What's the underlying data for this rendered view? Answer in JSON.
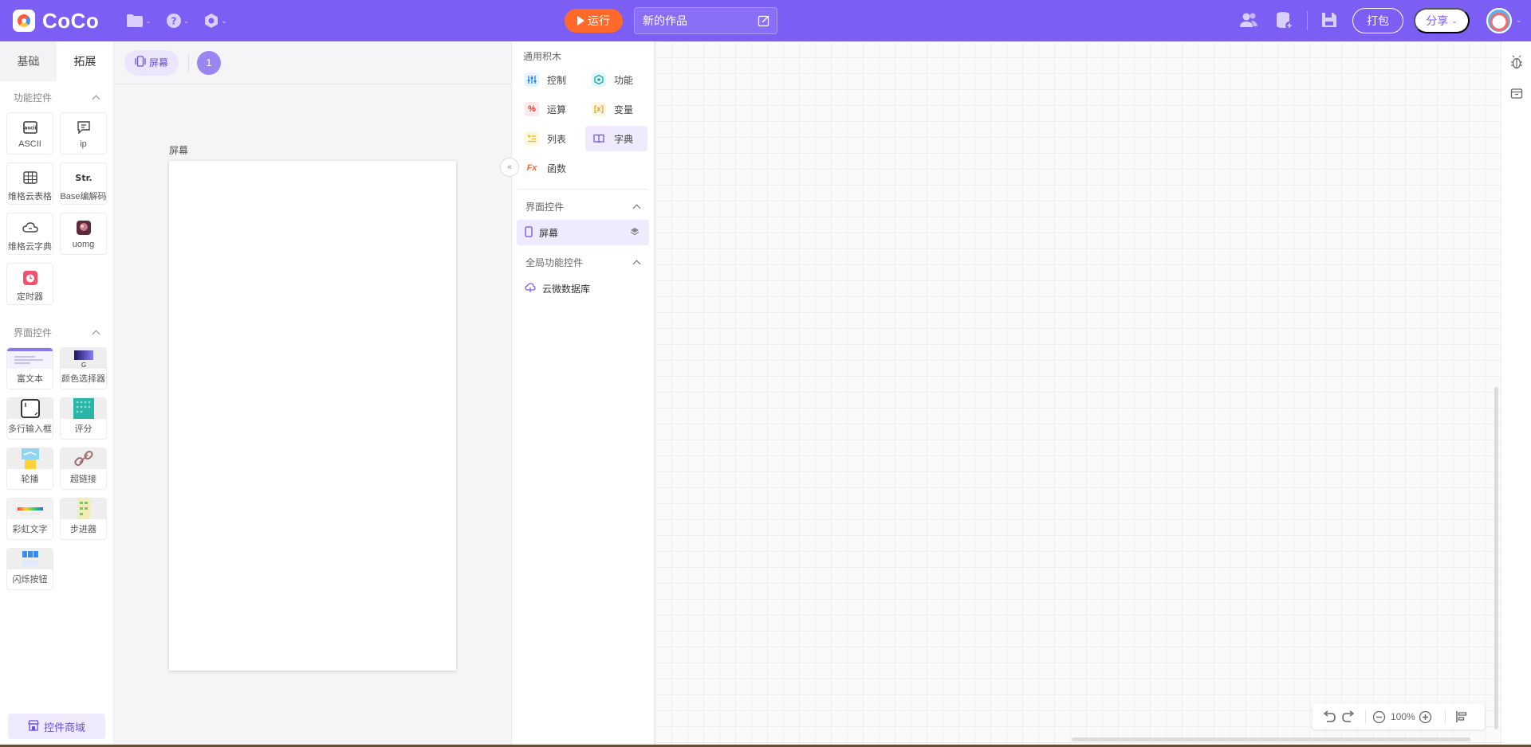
{
  "app": {
    "name": "CoCo"
  },
  "toolbar": {
    "file_icon": "folder-icon",
    "help_icon": "help-icon",
    "settings_icon": "settings-icon",
    "run_label": "运行",
    "project_title": "新的作品",
    "pack_label": "打包",
    "share_label": "分享"
  },
  "left_panel": {
    "tabs": [
      "基础",
      "拓展"
    ],
    "active_tab": "拓展",
    "section_function": "功能控件",
    "function_widgets": [
      "ASCII",
      "ip",
      "维格云表格",
      "Base编解码",
      "维格云字典",
      "uomg",
      "定时器"
    ],
    "section_ui": "界面控件",
    "ui_widgets": [
      "富文本",
      "颜色选择器",
      "多行输入框",
      "评分",
      "轮播",
      "超链接",
      "彩虹文字",
      "步进器",
      "闪烁按钮"
    ],
    "shop_label": "控件商域"
  },
  "stage": {
    "screen_chip": "屏幕",
    "page_number": "1",
    "canvas_label": "屏幕"
  },
  "blocks": {
    "title": "通用积木",
    "items": [
      "控制",
      "功能",
      "运算",
      "变量",
      "列表",
      "字典",
      "函数"
    ],
    "active_item": "字典",
    "ui_section": "界面控件",
    "ui_items": [
      "屏幕"
    ],
    "global_section": "全局功能控件",
    "global_items": [
      "云微数据库"
    ]
  },
  "zoom": {
    "level": "100%"
  },
  "colors": {
    "brand": "#7d5ef5",
    "run": "#ff6a2b",
    "accent_light": "#efeafd"
  }
}
